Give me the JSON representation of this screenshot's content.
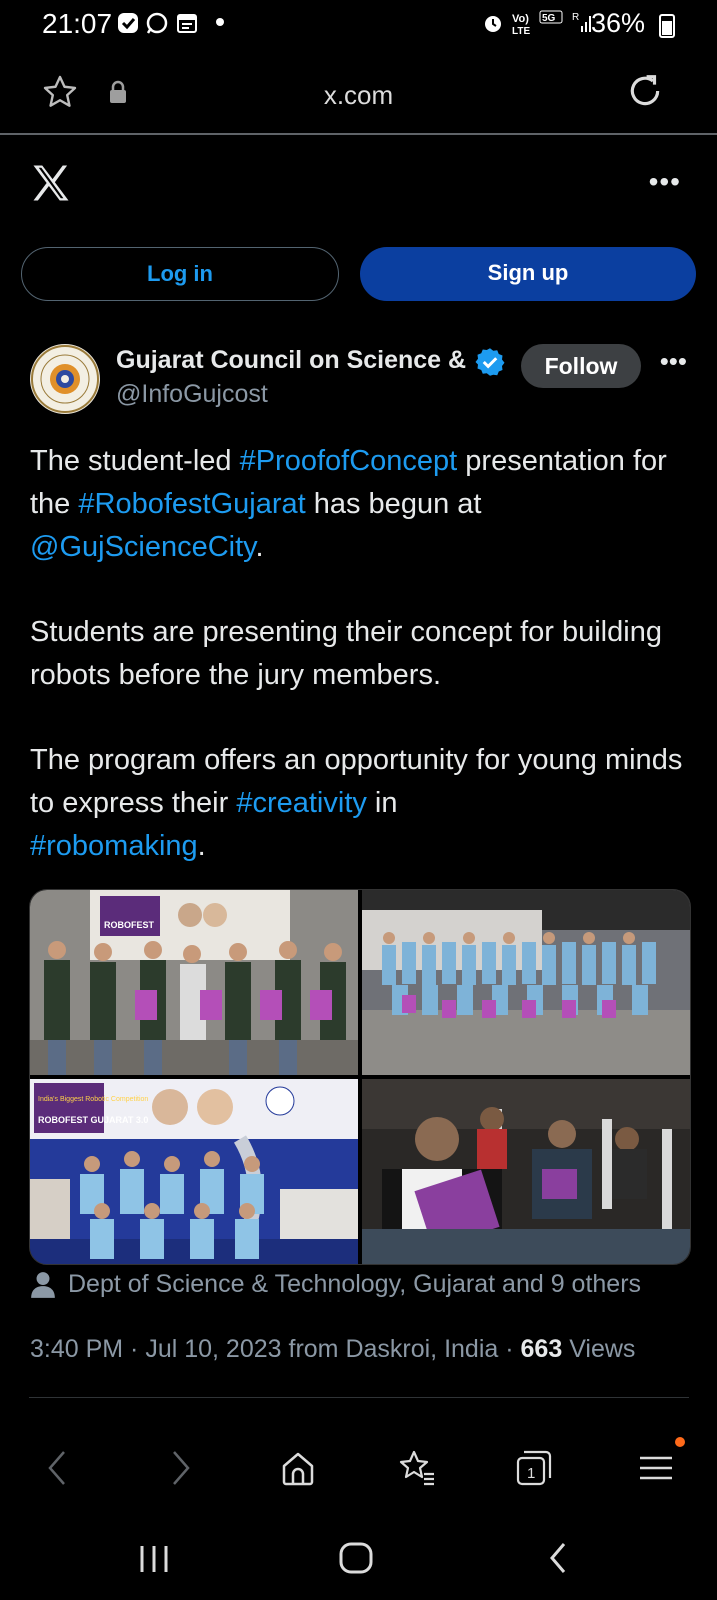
{
  "status_bar": {
    "time": "21:07",
    "right_text": "36%",
    "network": "5G"
  },
  "browser": {
    "url": "x.com"
  },
  "header": {
    "login_label": "Log in",
    "signup_label": "Sign up"
  },
  "tweet": {
    "author_name": "Gujarat Council on Science & Technology",
    "handle": "@InfoGujcost",
    "follow_label": "Follow",
    "para1": {
      "t1": "The student-led ",
      "l1": "#ProofofConcept",
      "t2": " presentation for the ",
      "l2": "#RobofestGujarat",
      "t3": " has begun at ",
      "l3": "@GujScienceCity",
      "t4": "."
    },
    "para2": "Students are presenting their concept for building robots before the jury members.",
    "para3": {
      "t1": "The program offers an opportunity for young minds to express their ",
      "l1": "#creativity",
      "t2": " in ",
      "l2": "#robomaking",
      "t3": "."
    },
    "tagged": "Dept of Science & Technology, Gujarat and 9 others",
    "time": "3:40 PM",
    "date": "Jul 10, 2023",
    "location": "from Daskroi, India",
    "views_count": "663",
    "views_label": "Views"
  },
  "photos": {
    "banner_text": "ROBOFEST GUJARAT 3.0",
    "banner_text_2": "India's Biggest Robotic Competition"
  },
  "colors": {
    "accent": "#1d9bf0",
    "signup_bg": "#0b3fa0",
    "secondary_text": "#8b98a5"
  }
}
